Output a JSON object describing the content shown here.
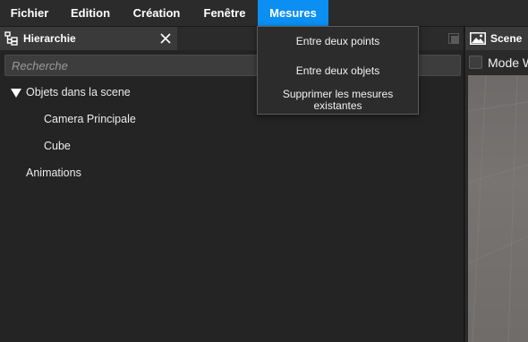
{
  "menubar": {
    "items": [
      {
        "label": "Fichier"
      },
      {
        "label": "Edition"
      },
      {
        "label": "Création"
      },
      {
        "label": "Fenêtre"
      },
      {
        "label": "Mesures",
        "active": true
      }
    ]
  },
  "mesures_menu": {
    "items": [
      {
        "label": "Entre deux points"
      },
      {
        "label": "Entre deux objets"
      },
      {
        "label": "Supprimer les mesures existantes"
      }
    ]
  },
  "hierarchy": {
    "title": "Hierarchie",
    "search_placeholder": "Recherche",
    "tree": [
      {
        "label": "Objets dans la scene",
        "expanded": true
      },
      {
        "label": "Camera Principale"
      },
      {
        "label": "Cube"
      },
      {
        "label": "Animations"
      }
    ]
  },
  "scene": {
    "title": "Scene",
    "mode_label": "Mode W"
  },
  "colors": {
    "accent": "#0b8ff2",
    "background": "#1e1e1e",
    "panel": "#242424"
  },
  "icons": {
    "hierarchy_tab": "hierarchy-icon",
    "close": "close-icon",
    "maximize": "maximize-icon",
    "tree_toggle": "triangle-down-icon",
    "scene_tab": "image-icon"
  }
}
